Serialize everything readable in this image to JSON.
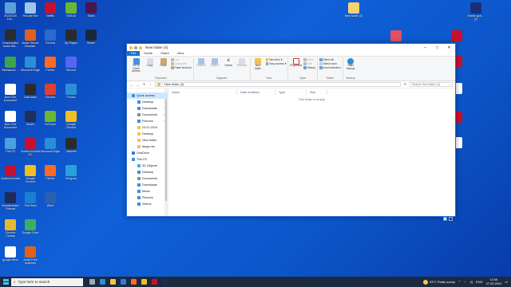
{
  "desktop": {
    "icons": [
      {
        "label": "20220330 133...",
        "color": "#5da0d8"
      },
      {
        "label": "Downloaded Audio Mix...",
        "color": "#2b2b2b"
      },
      {
        "label": "Bluestacks ...",
        "color": "#3ea34a"
      },
      {
        "label": "New Text Document",
        "color": "#ffffff"
      },
      {
        "label": "New Text Document",
        "color": "#ffffff"
      },
      {
        "label": "This PC",
        "color": "#4aa0e0"
      },
      {
        "label": "Adobe Acrobat",
        "color": "#c8102e"
      },
      {
        "label": "Wondershare Filmora",
        "color": "#1e2a5a"
      },
      {
        "label": "Chrome Canary",
        "color": "#e8b830"
      },
      {
        "label": "google-drive",
        "color": "#ffffff"
      },
      {
        "label": "Recycle Bin",
        "color": "#9fc6e8"
      },
      {
        "label": "Avast Secure Browser",
        "color": "#e06020"
      },
      {
        "label": "Microsoft Edge",
        "color": "#2a8fd8"
      },
      {
        "label": "Calculator",
        "color": "#2b2b2b"
      },
      {
        "label": "Studio",
        "color": "#1e2f5a"
      },
      {
        "label": "Adobe Acrobat DC",
        "color": "#c8102e"
      },
      {
        "label": "Google Chrome",
        "color": "#f0c020"
      },
      {
        "label": "TheClean",
        "color": "#1a7fd0"
      },
      {
        "label": "Google Drive",
        "color": "#3ab060"
      },
      {
        "label": "Avast Free Antivirus",
        "color": "#e06020"
      },
      {
        "label": "Netflix",
        "color": "#c8102e"
      },
      {
        "label": "Filmora",
        "color": "#2b6bd0"
      },
      {
        "label": "Firefox",
        "color": "#ff6a20"
      },
      {
        "label": "Chrome",
        "color": "#e04030"
      },
      {
        "label": "GeForce",
        "color": "#6cb830"
      },
      {
        "label": "Microsoft Edge",
        "color": "#2a8fd8"
      },
      {
        "label": "Firefox",
        "color": "#ff6a20"
      },
      {
        "label": "Word",
        "color": "#2b5fb0"
      },
      {
        "label": "NVIDIA",
        "color": "#6cb830"
      },
      {
        "label": "My Pages",
        "color": "#2b2b2b"
      },
      {
        "label": "Discord",
        "color": "#5865f2"
      },
      {
        "label": "Photos",
        "color": "#2a8fd8"
      },
      {
        "label": "Google Chrome",
        "color": "#f0c020"
      },
      {
        "label": "Valorant",
        "color": "#2b2b2b"
      },
      {
        "label": "Telegram",
        "color": "#2aa1da"
      },
      {
        "label": "Slack",
        "color": "#4a154b"
      },
      {
        "label": "Steam",
        "color": "#1b2838"
      },
      {
        "label": "Riot",
        "color": "#d0202a"
      },
      {
        "label": "Wondershare",
        "color": "#1e2a5a"
      },
      {
        "label": "Epic",
        "color": "#e6e6e6"
      },
      {
        "label": "VLC media player",
        "color": "#ff8c00"
      },
      {
        "label": "Internet Download Mgr",
        "color": "#3ab060"
      },
      {
        "label": "Screenshot",
        "color": "#c8102e"
      }
    ],
    "right_icons": [
      {
        "label": "New folder (3)",
        "color": "#f7d070"
      },
      {
        "label": "techie-spot... (1)",
        "color": "#1a2f7a"
      },
      {
        "label": "",
        "color": "#e05060"
      },
      {
        "label": "",
        "color": "#c8102e"
      },
      {
        "label": "",
        "color": "#c8102e"
      },
      {
        "label": "",
        "color": "#ffffff"
      },
      {
        "label": "",
        "color": "#c8102e"
      },
      {
        "label": "",
        "color": "#ffffff"
      }
    ]
  },
  "window": {
    "title": "New folder (4)",
    "tabs": [
      "File",
      "Home",
      "Share",
      "View"
    ],
    "ribbon": {
      "clipboard": {
        "label": "Clipboard",
        "pin": "Pin to Quick access",
        "copy": "Copy",
        "paste": "Paste",
        "cut": "Cut",
        "copy_path": "Copy path",
        "paste_shortcut": "Paste shortcut"
      },
      "organize": {
        "label": "Organize",
        "move_to": "Move to",
        "copy_to": "Copy to",
        "delete": "Delete",
        "rename": "Rename"
      },
      "new": {
        "label": "New",
        "new_folder": "New folder",
        "new_item": "New item",
        "easy_access": "Easy access"
      },
      "open": {
        "label": "Open",
        "properties": "Properties",
        "open": "Open",
        "edit": "Edit",
        "history": "History"
      },
      "select": {
        "label": "Select",
        "select_all": "Select all",
        "select_none": "Select none",
        "invert": "Invert selection"
      },
      "backup": {
        "label": "Backup",
        "start_backup": "Start backup"
      }
    },
    "address": {
      "path": "New folder (4)",
      "search_placeholder": "Search New folder (4)"
    },
    "nav": [
      {
        "label": "Quick access",
        "type": "header",
        "color": "#3b8ee0"
      },
      {
        "label": "Desktop",
        "type": "sub",
        "color": "#3b8ee0",
        "pinned": true
      },
      {
        "label": "Downloads",
        "type": "sub",
        "color": "#3b8ee0",
        "pinned": true
      },
      {
        "label": "Documents",
        "type": "sub",
        "color": "#8c8c8c",
        "pinned": true
      },
      {
        "label": "Pictures",
        "type": "sub",
        "color": "#3b8ee0",
        "pinned": true
      },
      {
        "label": "23.01.2024",
        "type": "sub",
        "color": "#f2c24f",
        "pinned": false
      },
      {
        "label": "Desktop",
        "type": "sub",
        "color": "#f2c24f",
        "pinned": false
      },
      {
        "label": "New folder",
        "type": "sub",
        "color": "#f2c24f",
        "pinned": false
      },
      {
        "label": "fangs-res",
        "type": "sub",
        "color": "#f2c24f",
        "pinned": false
      },
      {
        "label": "OneDrive",
        "type": "header",
        "color": "#2a7fd4"
      },
      {
        "label": "This PC",
        "type": "header",
        "color": "#3b8ee0"
      },
      {
        "label": "3D Objects",
        "type": "sub",
        "color": "#4aa8e8",
        "pinned": false
      },
      {
        "label": "Desktop",
        "type": "sub",
        "color": "#3b8ee0",
        "pinned": false
      },
      {
        "label": "Documents",
        "type": "sub",
        "color": "#8c8c8c",
        "pinned": false
      },
      {
        "label": "Downloads",
        "type": "sub",
        "color": "#3b8ee0",
        "pinned": false
      },
      {
        "label": "Music",
        "type": "sub",
        "color": "#3b8ee0",
        "pinned": false
      },
      {
        "label": "Pictures",
        "type": "sub",
        "color": "#3b8ee0",
        "pinned": false
      },
      {
        "label": "Videos",
        "type": "sub",
        "color": "#3b8ee0",
        "pinned": false
      }
    ],
    "columns": [
      "Name",
      "Date modified",
      "Type",
      "Size"
    ],
    "empty_message": "This folder is empty."
  },
  "taskbar": {
    "search_placeholder": "Type here to search",
    "weather": "23°C  Partly sunny",
    "language": "ENG",
    "time": "12:46",
    "date": "27-02-2024"
  }
}
